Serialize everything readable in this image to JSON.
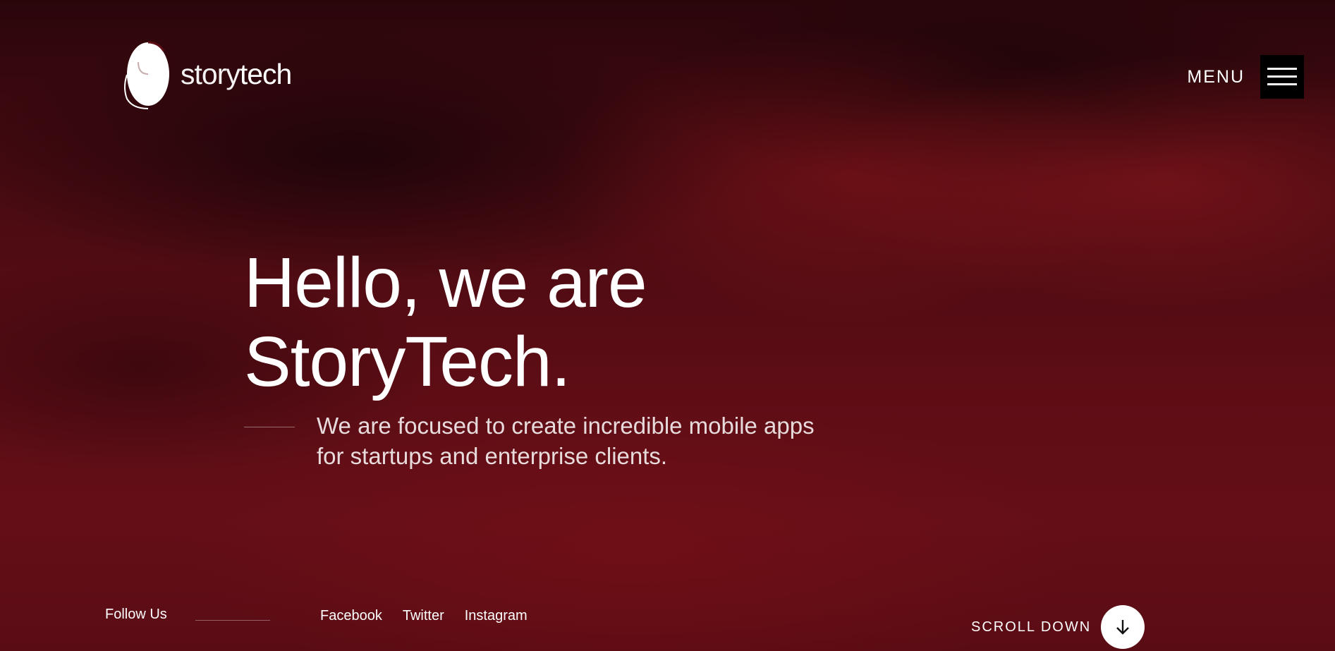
{
  "header": {
    "logo": {
      "text_light": "story",
      "text_bold": "tech",
      "icon": "storytech-logo-icon"
    },
    "menu": {
      "label": "MENU",
      "icon": "hamburger-icon"
    }
  },
  "hero": {
    "title_line1": "Hello, we are",
    "title_line2": "StoryTech.",
    "subtitle_line1": "We are focused to create incredible mobile apps",
    "subtitle_line2": "for startups and enterprise clients."
  },
  "footer": {
    "follow_label": "Follow Us",
    "social": [
      "Facebook",
      "Twitter",
      "Instagram"
    ],
    "scroll_label": "SCROLL DOWN",
    "scroll_icon": "arrow-down-icon"
  },
  "colors": {
    "background": "#5e0d15",
    "text": "#ffffff",
    "menu_button_bg": "#000000"
  }
}
